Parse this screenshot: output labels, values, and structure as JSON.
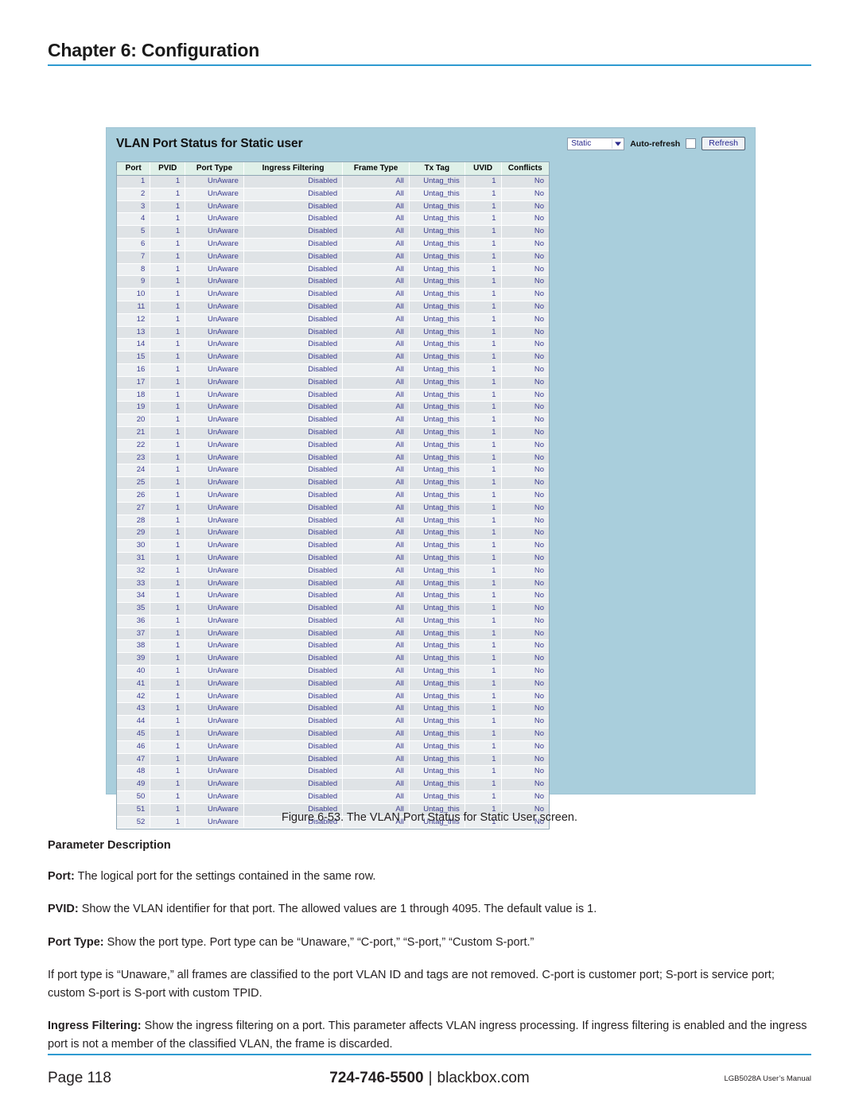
{
  "page_header": {
    "chapter_title": "Chapter 6: Configuration",
    "rule_color": "#2e9ad0"
  },
  "screenshot": {
    "panel_bg": "#a9cedc",
    "title": "VLAN Port Status for Static user",
    "toolbar": {
      "select_value": "Static",
      "select_icon": "chevron-down-icon",
      "auto_refresh_label": "Auto-refresh",
      "auto_refresh_checked": false,
      "refresh_label": "Refresh"
    },
    "table": {
      "header_bg": "#dff0e8",
      "cell_text_color": "#3b3b8f",
      "columns": [
        "Port",
        "PVID",
        "Port Type",
        "Ingress Filtering",
        "Frame Type",
        "Tx Tag",
        "UVID",
        "Conflicts"
      ],
      "rows": [
        [
          "1",
          "1",
          "UnAware",
          "Disabled",
          "All",
          "Untag_this",
          "1",
          "No"
        ],
        [
          "2",
          "1",
          "UnAware",
          "Disabled",
          "All",
          "Untag_this",
          "1",
          "No"
        ],
        [
          "3",
          "1",
          "UnAware",
          "Disabled",
          "All",
          "Untag_this",
          "1",
          "No"
        ],
        [
          "4",
          "1",
          "UnAware",
          "Disabled",
          "All",
          "Untag_this",
          "1",
          "No"
        ],
        [
          "5",
          "1",
          "UnAware",
          "Disabled",
          "All",
          "Untag_this",
          "1",
          "No"
        ],
        [
          "6",
          "1",
          "UnAware",
          "Disabled",
          "All",
          "Untag_this",
          "1",
          "No"
        ],
        [
          "7",
          "1",
          "UnAware",
          "Disabled",
          "All",
          "Untag_this",
          "1",
          "No"
        ],
        [
          "8",
          "1",
          "UnAware",
          "Disabled",
          "All",
          "Untag_this",
          "1",
          "No"
        ],
        [
          "9",
          "1",
          "UnAware",
          "Disabled",
          "All",
          "Untag_this",
          "1",
          "No"
        ],
        [
          "10",
          "1",
          "UnAware",
          "Disabled",
          "All",
          "Untag_this",
          "1",
          "No"
        ],
        [
          "11",
          "1",
          "UnAware",
          "Disabled",
          "All",
          "Untag_this",
          "1",
          "No"
        ],
        [
          "12",
          "1",
          "UnAware",
          "Disabled",
          "All",
          "Untag_this",
          "1",
          "No"
        ],
        [
          "13",
          "1",
          "UnAware",
          "Disabled",
          "All",
          "Untag_this",
          "1",
          "No"
        ],
        [
          "14",
          "1",
          "UnAware",
          "Disabled",
          "All",
          "Untag_this",
          "1",
          "No"
        ],
        [
          "15",
          "1",
          "UnAware",
          "Disabled",
          "All",
          "Untag_this",
          "1",
          "No"
        ],
        [
          "16",
          "1",
          "UnAware",
          "Disabled",
          "All",
          "Untag_this",
          "1",
          "No"
        ],
        [
          "17",
          "1",
          "UnAware",
          "Disabled",
          "All",
          "Untag_this",
          "1",
          "No"
        ],
        [
          "18",
          "1",
          "UnAware",
          "Disabled",
          "All",
          "Untag_this",
          "1",
          "No"
        ],
        [
          "19",
          "1",
          "UnAware",
          "Disabled",
          "All",
          "Untag_this",
          "1",
          "No"
        ],
        [
          "20",
          "1",
          "UnAware",
          "Disabled",
          "All",
          "Untag_this",
          "1",
          "No"
        ],
        [
          "21",
          "1",
          "UnAware",
          "Disabled",
          "All",
          "Untag_this",
          "1",
          "No"
        ],
        [
          "22",
          "1",
          "UnAware",
          "Disabled",
          "All",
          "Untag_this",
          "1",
          "No"
        ],
        [
          "23",
          "1",
          "UnAware",
          "Disabled",
          "All",
          "Untag_this",
          "1",
          "No"
        ],
        [
          "24",
          "1",
          "UnAware",
          "Disabled",
          "All",
          "Untag_this",
          "1",
          "No"
        ],
        [
          "25",
          "1",
          "UnAware",
          "Disabled",
          "All",
          "Untag_this",
          "1",
          "No"
        ],
        [
          "26",
          "1",
          "UnAware",
          "Disabled",
          "All",
          "Untag_this",
          "1",
          "No"
        ],
        [
          "27",
          "1",
          "UnAware",
          "Disabled",
          "All",
          "Untag_this",
          "1",
          "No"
        ],
        [
          "28",
          "1",
          "UnAware",
          "Disabled",
          "All",
          "Untag_this",
          "1",
          "No"
        ],
        [
          "29",
          "1",
          "UnAware",
          "Disabled",
          "All",
          "Untag_this",
          "1",
          "No"
        ],
        [
          "30",
          "1",
          "UnAware",
          "Disabled",
          "All",
          "Untag_this",
          "1",
          "No"
        ],
        [
          "31",
          "1",
          "UnAware",
          "Disabled",
          "All",
          "Untag_this",
          "1",
          "No"
        ],
        [
          "32",
          "1",
          "UnAware",
          "Disabled",
          "All",
          "Untag_this",
          "1",
          "No"
        ],
        [
          "33",
          "1",
          "UnAware",
          "Disabled",
          "All",
          "Untag_this",
          "1",
          "No"
        ],
        [
          "34",
          "1",
          "UnAware",
          "Disabled",
          "All",
          "Untag_this",
          "1",
          "No"
        ],
        [
          "35",
          "1",
          "UnAware",
          "Disabled",
          "All",
          "Untag_this",
          "1",
          "No"
        ],
        [
          "36",
          "1",
          "UnAware",
          "Disabled",
          "All",
          "Untag_this",
          "1",
          "No"
        ],
        [
          "37",
          "1",
          "UnAware",
          "Disabled",
          "All",
          "Untag_this",
          "1",
          "No"
        ],
        [
          "38",
          "1",
          "UnAware",
          "Disabled",
          "All",
          "Untag_this",
          "1",
          "No"
        ],
        [
          "39",
          "1",
          "UnAware",
          "Disabled",
          "All",
          "Untag_this",
          "1",
          "No"
        ],
        [
          "40",
          "1",
          "UnAware",
          "Disabled",
          "All",
          "Untag_this",
          "1",
          "No"
        ],
        [
          "41",
          "1",
          "UnAware",
          "Disabled",
          "All",
          "Untag_this",
          "1",
          "No"
        ],
        [
          "42",
          "1",
          "UnAware",
          "Disabled",
          "All",
          "Untag_this",
          "1",
          "No"
        ],
        [
          "43",
          "1",
          "UnAware",
          "Disabled",
          "All",
          "Untag_this",
          "1",
          "No"
        ],
        [
          "44",
          "1",
          "UnAware",
          "Disabled",
          "All",
          "Untag_this",
          "1",
          "No"
        ],
        [
          "45",
          "1",
          "UnAware",
          "Disabled",
          "All",
          "Untag_this",
          "1",
          "No"
        ],
        [
          "46",
          "1",
          "UnAware",
          "Disabled",
          "All",
          "Untag_this",
          "1",
          "No"
        ],
        [
          "47",
          "1",
          "UnAware",
          "Disabled",
          "All",
          "Untag_this",
          "1",
          "No"
        ],
        [
          "48",
          "1",
          "UnAware",
          "Disabled",
          "All",
          "Untag_this",
          "1",
          "No"
        ],
        [
          "49",
          "1",
          "UnAware",
          "Disabled",
          "All",
          "Untag_this",
          "1",
          "No"
        ],
        [
          "50",
          "1",
          "UnAware",
          "Disabled",
          "All",
          "Untag_this",
          "1",
          "No"
        ],
        [
          "51",
          "1",
          "UnAware",
          "Disabled",
          "All",
          "Untag_this",
          "1",
          "No"
        ],
        [
          "52",
          "1",
          "UnAware",
          "Disabled",
          "All",
          "Untag_this",
          "1",
          "No"
        ]
      ]
    }
  },
  "figure": {
    "caption": "Figure 6-53. The VLAN Port Status for Static User screen."
  },
  "body": {
    "subhead": "Parameter Description",
    "paragraphs": [
      {
        "term": "Port:",
        "text": " The logical port for the settings contained in the same row."
      },
      {
        "term": "PVID:",
        "text": " Show the VLAN identifier for that port. The allowed values are 1 through 4095. The default value is 1."
      },
      {
        "term": "Port Type:",
        "text": " Show the port type. Port type can be “Unaware,” “C-port,” “S-port,” “Custom S-port.”"
      },
      {
        "term": "",
        "text": "If port type is “Unaware,” all frames are classified to the port VLAN ID and tags are not removed. C-port is customer port; S-port is service port; custom S-port is S-port with custom TPID."
      },
      {
        "term": "Ingress Filtering:",
        "text": " Show the ingress filtering on a port. This parameter affects VLAN ingress processing. If ingress filtering is enabled and the ingress port is not a member of the classified VLAN, the frame is discarded."
      }
    ]
  },
  "footer": {
    "page_label": "Page 118",
    "phone": "724-746-5500",
    "separator": "|",
    "site": "blackbox.com",
    "manual": "LGB5028A User’s Manual",
    "rule_color": "#2e9ad0"
  }
}
